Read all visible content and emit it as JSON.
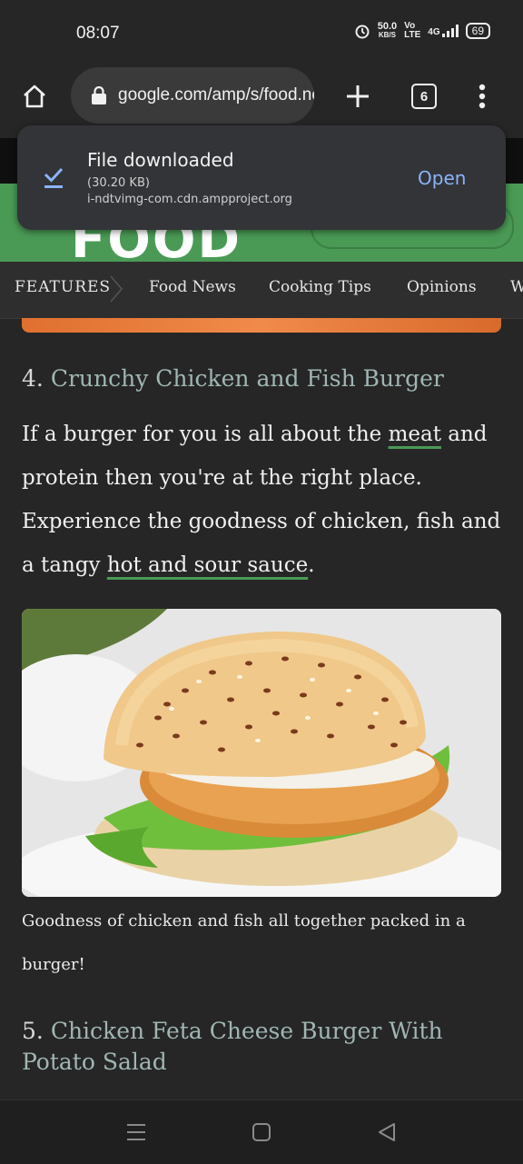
{
  "status": {
    "time": "08:07",
    "net_speed": "50.0",
    "net_unit": "KB/S",
    "volte_top": "Vo",
    "volte_bottom": "LTE",
    "network": "4G",
    "battery": "69"
  },
  "browser": {
    "url": "google.com/amp/s/food.ndtv.com",
    "tab_count": "6"
  },
  "download_toast": {
    "title": "File downloaded",
    "size": "(30.20 KB)",
    "source": "i-ndtvimg-com.cdn.ampproject.org",
    "action": "Open"
  },
  "site": {
    "logo": "FOOD"
  },
  "categories": [
    "FEATURES",
    "Food News",
    "Cooking Tips",
    "Opinions",
    "W"
  ],
  "article": {
    "item4": {
      "number": "4.",
      "title": "Crunchy Chicken and Fish Burger",
      "text_1": "If a burger for you is all about the ",
      "link_meat": "meat",
      "text_2": " and protein then you're at the right place. Experience the goodness of chicken, fish and a tangy ",
      "link_sauce": "hot and sour sauce",
      "text_3": "."
    },
    "image_caption": "Goodness of chicken and fish all together packed in a burger!",
    "item5": {
      "number": "5.",
      "title": "Chicken Feta Cheese Burger With Potato Salad"
    }
  },
  "icons": {
    "home": "home-icon",
    "lock": "lock-icon",
    "new_tab": "plus-icon",
    "menu": "more-vert-icon",
    "download_done": "download-done-icon",
    "recent_apps": "menu-lines-icon",
    "home_nav": "square-icon",
    "back": "triangle-back-icon"
  },
  "colors": {
    "background": "#262626",
    "brand_green": "#4a9a55",
    "link_blue": "#8ab4f8",
    "title_link": "#9fb6b3"
  }
}
